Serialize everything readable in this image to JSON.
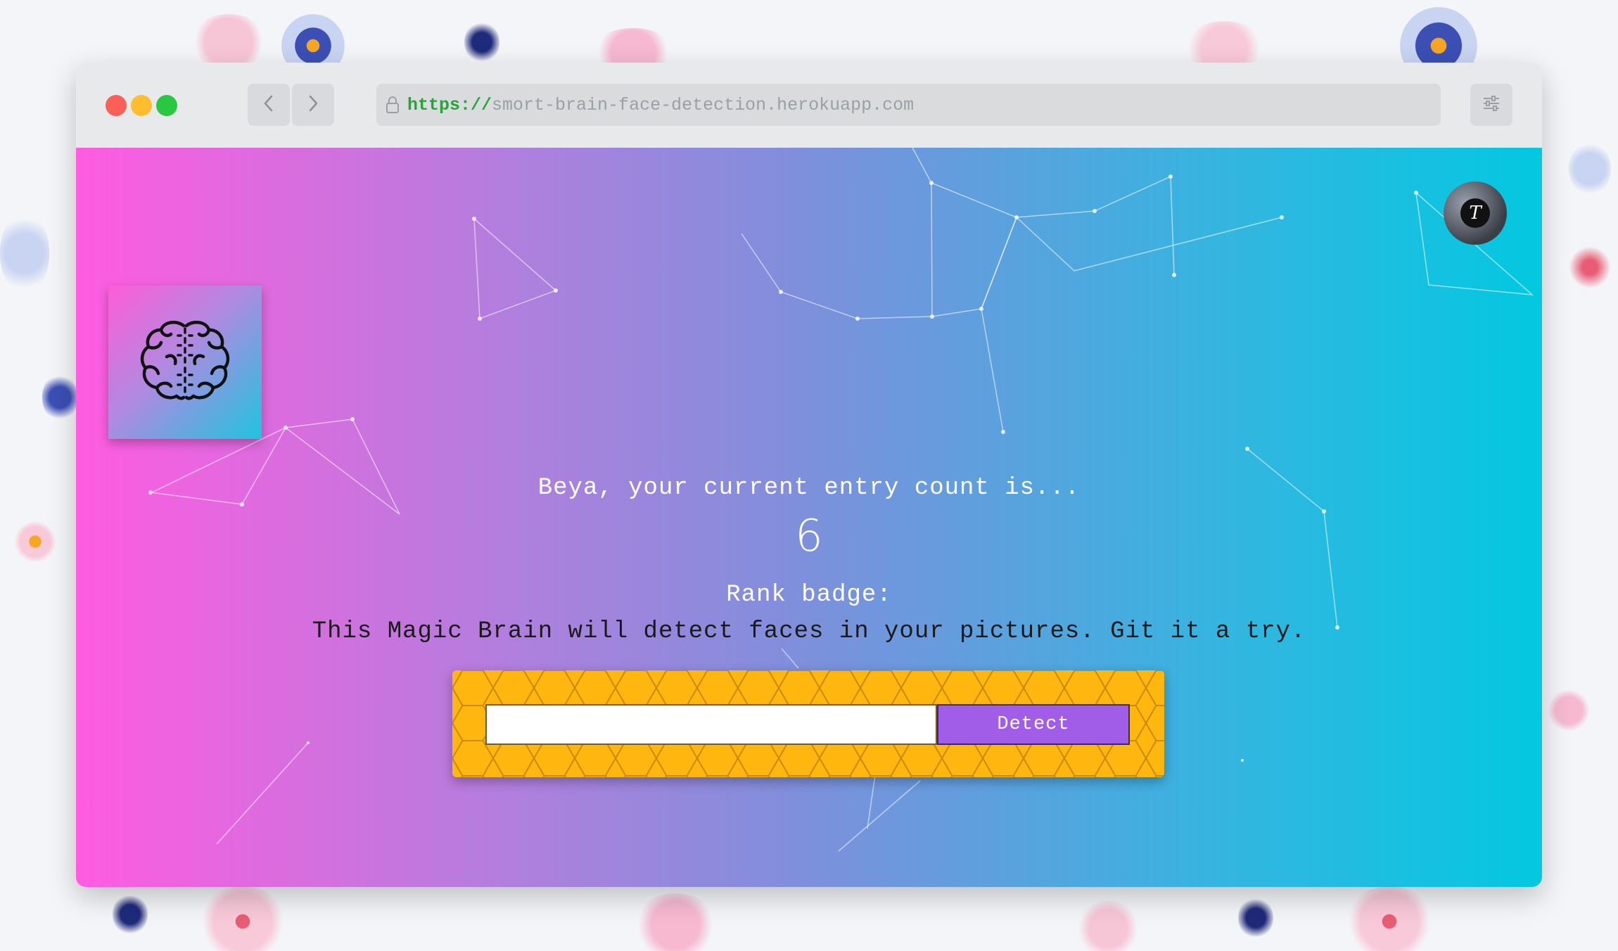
{
  "browser": {
    "url_scheme": "https://",
    "url_host": "smort-brain-face-detection.herokuapp.com"
  },
  "icons": {
    "logo": "brain-icon",
    "avatar": "user-avatar",
    "back": "chevron-left-icon",
    "forward": "chevron-right-icon",
    "lock": "lock-icon",
    "menu": "sliders-icon"
  },
  "avatar": {
    "initial": "T"
  },
  "main": {
    "greeting": "Beya, your current entry count is...",
    "entry_count": "6",
    "rank_label": "Rank badge:",
    "description": "This Magic Brain will detect faces in your pictures. Git it a try."
  },
  "form": {
    "input_value": "",
    "detect_label": "Detect"
  },
  "colors": {
    "gradient_start": "#ff5ce0",
    "gradient_end": "#03c8e0",
    "form_background": "#ffb70f",
    "detect_button": "#a25de8"
  }
}
